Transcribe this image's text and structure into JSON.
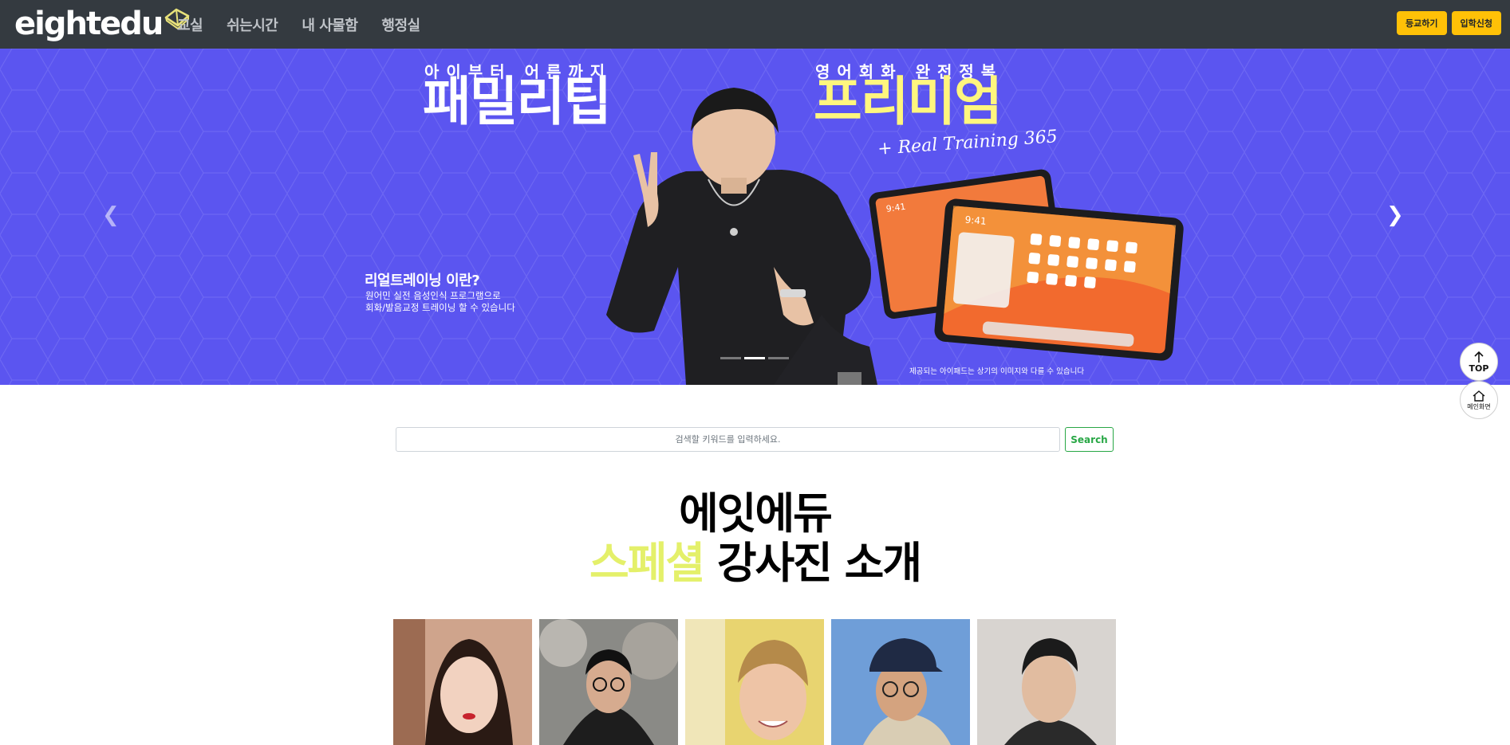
{
  "navbar": {
    "logo_text": "eightedu",
    "logo_icon": "book-icon",
    "links": [
      "교실",
      "쉬는시간",
      "내 사물함",
      "행정실"
    ],
    "buttons": [
      "등교하기",
      "입학신청"
    ]
  },
  "carousel": {
    "left_small": "아이부터 어른까지",
    "left_big": "패밀리팁",
    "right_small": "영어회화 완전정복",
    "right_big": "프리미엄",
    "script": "+ Real Training 365",
    "rt_title": "리얼트레이닝 이란?",
    "rt_line1": "원어민 실전 음성인식 프로그램으로",
    "rt_line2": "회화/발음교정 트레이닝 할 수 있습니다",
    "note": "제공되는 아이패드는 상기의 이미지와 다를 수 있습니다",
    "tablet_time": "9:41",
    "prev_icon": "chevron-left-icon",
    "next_icon": "chevron-right-icon",
    "active_slide": 2,
    "slide_count": 3,
    "colors": {
      "background": "#5b55f0",
      "highlight": "#fff67e"
    }
  },
  "floating": {
    "top_label": "TOP",
    "top_icon": "arrow-up-icon",
    "home_label": "메인화면",
    "home_icon": "home-icon"
  },
  "search": {
    "placeholder": "검색할 키워드를 입력하세요.",
    "button": "Search"
  },
  "intro": {
    "line1": "에잇에듀",
    "line2_highlight": "스페셜",
    "line2_rest": " 강사진 소개"
  },
  "instructors": {
    "count": 5
  },
  "colors": {
    "navbar": "#343a40",
    "accent_button": "#ffc107",
    "search_button": "#28a745",
    "heading_highlight": "#e4f06a"
  }
}
